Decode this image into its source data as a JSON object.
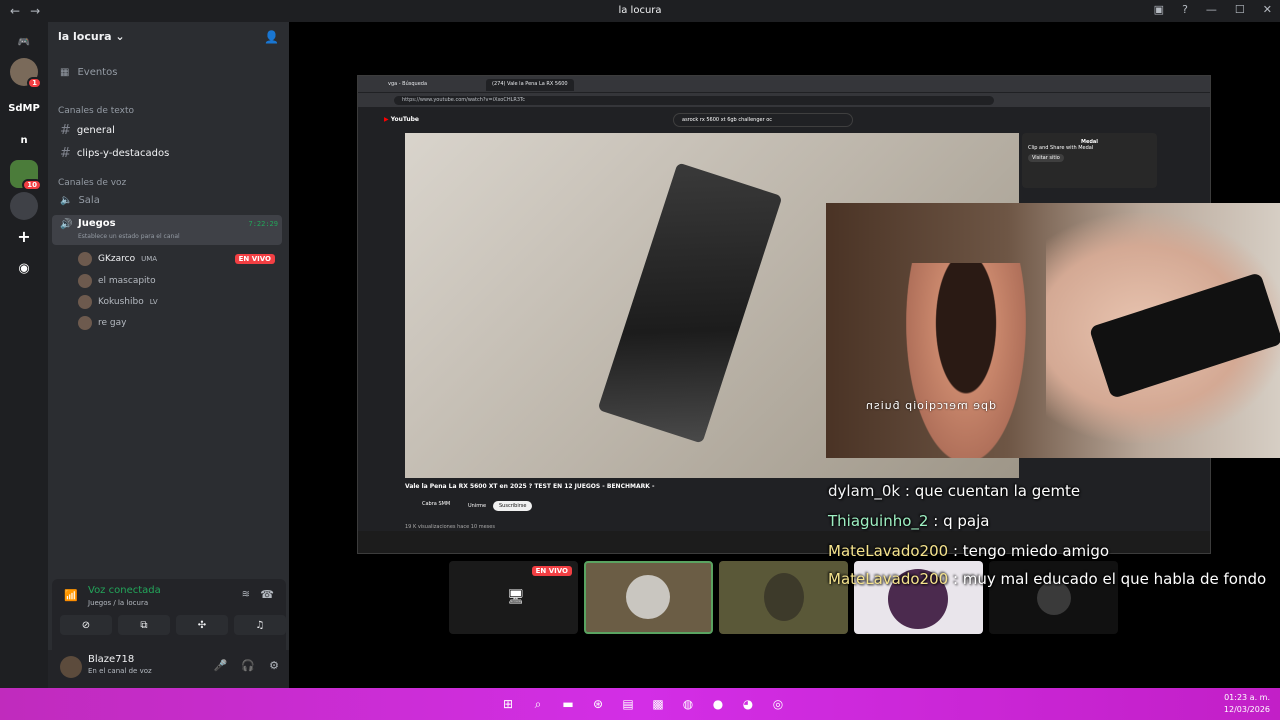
{
  "window": {
    "title": "la locura"
  },
  "servers": [
    {
      "label": "",
      "badge": "1"
    },
    {
      "label": "SdMP",
      "badge": ""
    },
    {
      "label": "n",
      "badge": ""
    },
    {
      "label": "",
      "badge": "10"
    },
    {
      "label": "",
      "badge": ""
    }
  ],
  "guild": {
    "name": "la locura"
  },
  "sidebar": {
    "events": "Eventos",
    "text_category": "Canales de texto",
    "text_channels": [
      "general",
      "clips-y-destacados"
    ],
    "voice_category": "Canales de voz",
    "voice_channels": [
      {
        "name": "Sala"
      },
      {
        "name": "Juegos",
        "time": "7:22:29",
        "status": "Establece un estado para el canal"
      }
    ],
    "voice_users": [
      {
        "name": "GKzarco",
        "tag": "UMA",
        "live": "EN VIVO"
      },
      {
        "name": "el mascapito",
        "tag": ""
      },
      {
        "name": "Kokushibo",
        "tag": "LV"
      },
      {
        "name": "re gay",
        "tag": ""
      }
    ]
  },
  "voice_panel": {
    "status": "Voz conectada",
    "channel": "Juegos / la locura"
  },
  "user_panel": {
    "name": "Blaze718",
    "status": "En el canal de voz"
  },
  "browser": {
    "tabs": [
      "vga - Búsqueda",
      "(274) Vale la Pena La RX 5600"
    ],
    "url": "https://www.youtube.com/watch?v=iXxoCHLR3Tc",
    "search": "asrock rx 5600 xt 6gb challenger oc",
    "video_title": "Vale la Pena La RX 5600 XT en 2025 ? TEST EN 12 JUEGOS - BENCHMARK -",
    "channel": "Cabra SMM",
    "subscribe": "Suscribirse",
    "join": "Unirme",
    "meta": "19 K visualizaciones hace 10 meses",
    "ad_title": "Clip and Share with Medal",
    "ad_brand": "Medal",
    "ad_button": "Visitar sitio"
  },
  "webcam": {
    "mirrored_text": "dpe mercqioip ɓuisn"
  },
  "chat": [
    {
      "user": "dylam_0k",
      "text": "que cuentan la gemte"
    },
    {
      "user": "Thiaguinho_2",
      "text": "q paja"
    },
    {
      "user": "MateLavado200",
      "text": "tengo miedo amigo"
    },
    {
      "user": "MateLavado200",
      "text": "muy mal educado el que habla de fondo"
    }
  ],
  "tiles": [
    {
      "live": "EN VIVO"
    }
  ],
  "taskbar": {
    "time": "01:23 a. m.",
    "date": "12/03/2026"
  }
}
